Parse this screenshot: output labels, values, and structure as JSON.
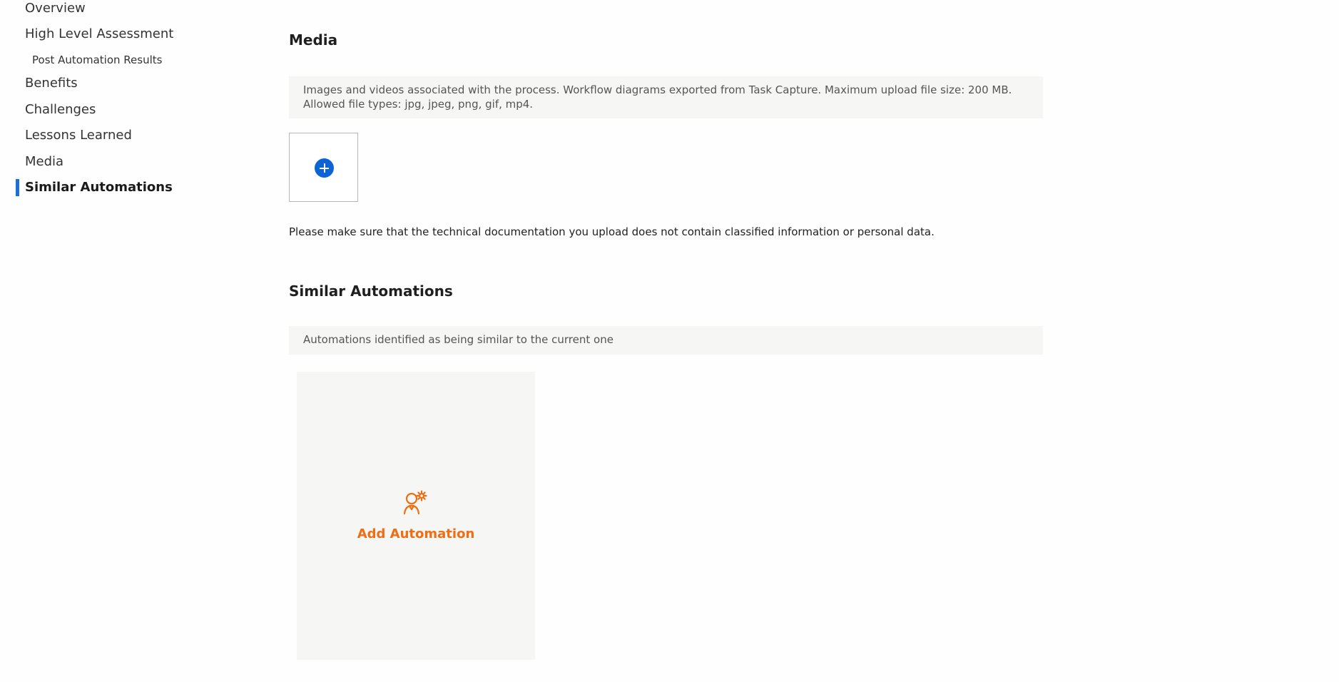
{
  "sidebar": {
    "items": [
      {
        "label": "Overview"
      },
      {
        "label": "High Level Assessment"
      },
      {
        "label": "Post Automation Results"
      },
      {
        "label": "Benefits"
      },
      {
        "label": "Challenges"
      },
      {
        "label": "Lessons Learned"
      },
      {
        "label": "Media"
      },
      {
        "label": "Similar Automations",
        "active": true
      }
    ]
  },
  "media": {
    "title": "Media",
    "info": "Images and videos associated with the process. Workflow diagrams exported from Task Capture. Maximum upload file size: 200 MB. Allowed file types: jpg, jpeg, png, gif, mp4.",
    "upload_icon": "plus-circle-icon",
    "notice": "Please make sure that the technical documentation you upload does not contain classified information or personal data."
  },
  "similar": {
    "title": "Similar Automations",
    "info": "Automations identified as being similar to the current one",
    "add_label": "Add Automation",
    "add_icon": "user-gear-icon"
  },
  "colors": {
    "accent_blue": "#0b63d6",
    "active_bar": "#1a6fd8",
    "accent_orange": "#f06d12",
    "panel_bg": "#f6f6f5"
  }
}
